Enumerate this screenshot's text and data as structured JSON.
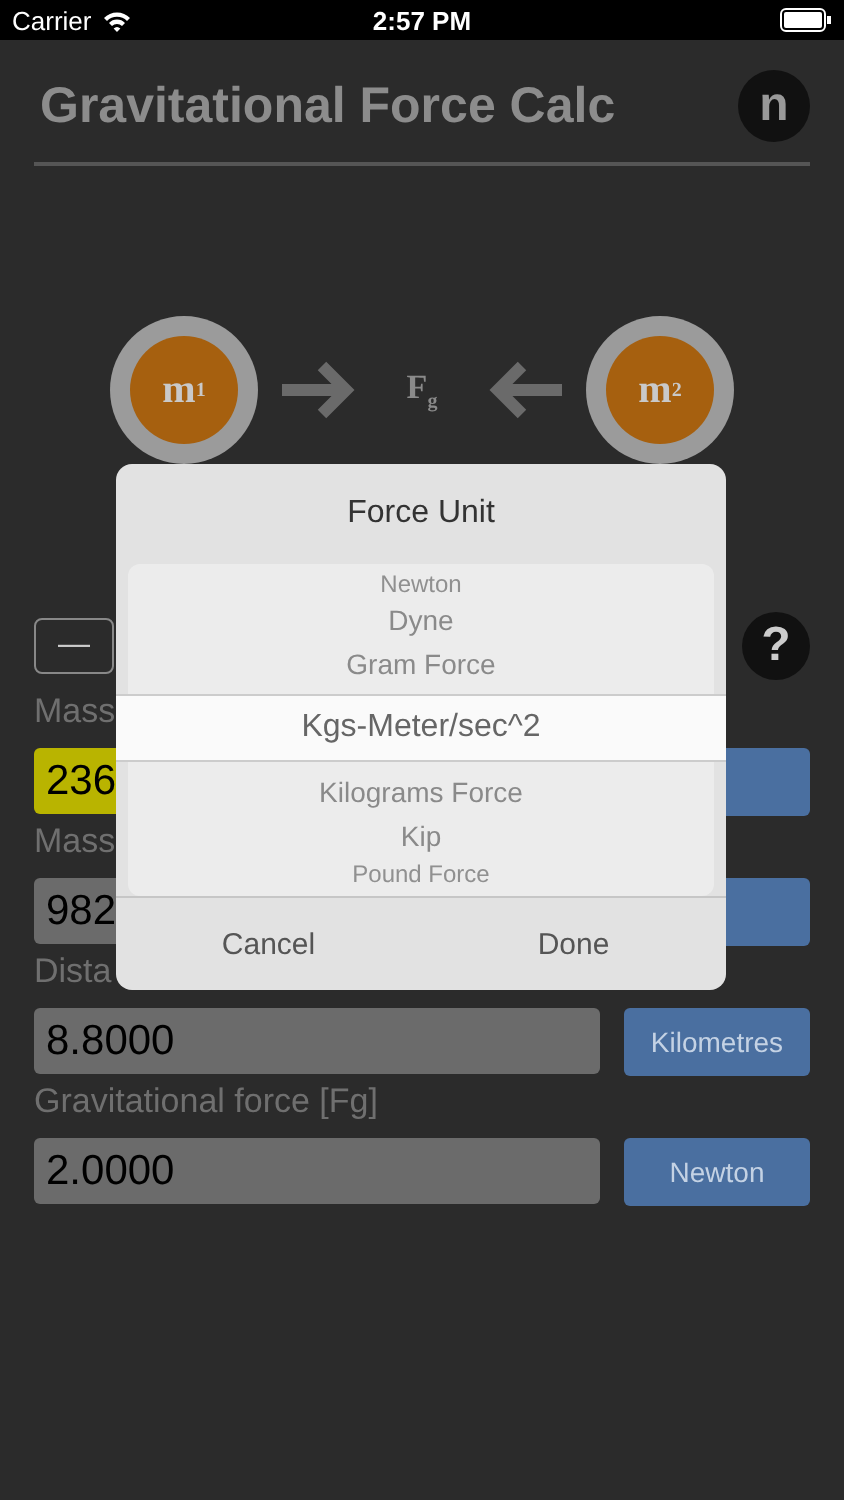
{
  "status_bar": {
    "carrier": "Carrier",
    "time": "2:57 PM"
  },
  "header": {
    "title": "Gravitational Force Calc",
    "badge": "n"
  },
  "diagram": {
    "mass_1": "m",
    "mass_1_index": "1",
    "mass_2": "m",
    "mass_2_index": "2",
    "force": "F",
    "force_index": "g"
  },
  "toolbar": {
    "minus": "—",
    "help": "?"
  },
  "fields": [
    {
      "label": "Mass",
      "value": "236",
      "highlighted": true
    },
    {
      "label": "Mass",
      "value": "982",
      "highlighted": false
    },
    {
      "label": "Dista",
      "value": "8.8000",
      "highlighted": false,
      "unit": "Kilometres"
    },
    {
      "label": "Gravitational force [Fg]",
      "value": "2.0000",
      "highlighted": false,
      "unit": "Newton"
    }
  ],
  "dialog": {
    "title": "Force Unit",
    "options": [
      {
        "label": "Newton",
        "selected": false
      },
      {
        "label": "Dyne",
        "selected": false
      },
      {
        "label": "Gram Force",
        "selected": false
      },
      {
        "label": "Kgs-Meter/sec^2",
        "selected": true
      },
      {
        "label": "Kilograms Force",
        "selected": false
      },
      {
        "label": "Kip",
        "selected": false
      },
      {
        "label": "Pound Force",
        "selected": false
      }
    ],
    "buttons": [
      "Cancel",
      "Done"
    ]
  }
}
